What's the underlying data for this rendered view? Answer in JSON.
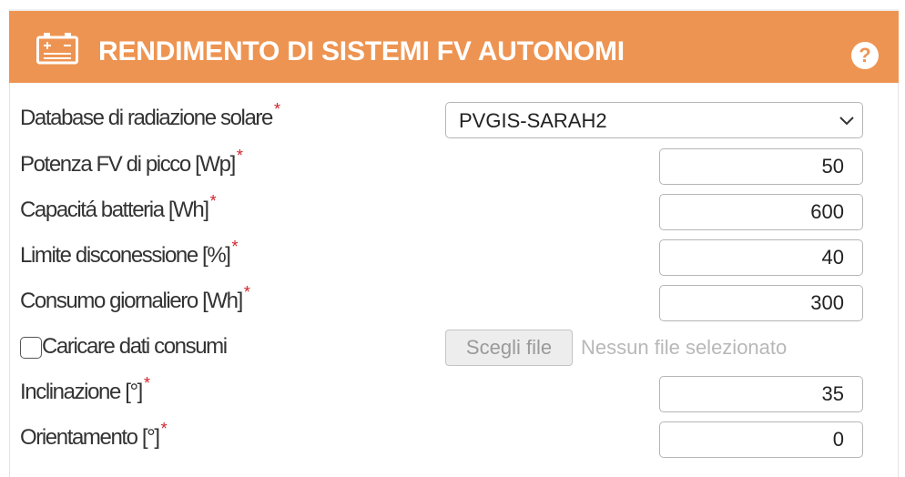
{
  "header": {
    "title": "RENDIMENTO DI SISTEMI FV AUTONOMI",
    "icon": "battery-icon",
    "help_icon": "?"
  },
  "colors": {
    "header_bg": "#ee9452",
    "required_mark": "#d0232a"
  },
  "form": {
    "radiation_db": {
      "label": "Database di radiazione solare",
      "value": "PVGIS-SARAH2"
    },
    "peak_power": {
      "label": "Potenza FV di picco [Wp]",
      "value": "50"
    },
    "battery_capacity": {
      "label": "Capacitá batteria [Wh]",
      "value": "600"
    },
    "cutoff_limit": {
      "label": "Limite disconessione [%]",
      "value": "40"
    },
    "daily_consumption": {
      "label": "Consumo giornaliero [Wh]",
      "value": "300"
    },
    "upload_consumption": {
      "label": "Caricare dati consumi",
      "checked": false,
      "button_label": "Scegli file",
      "file_status": "Nessun file selezionato"
    },
    "slope": {
      "label": "Inclinazione [°]",
      "value": "35"
    },
    "azimuth": {
      "label": "Orientamento [°]",
      "value": "0"
    },
    "required_mark": "*"
  }
}
